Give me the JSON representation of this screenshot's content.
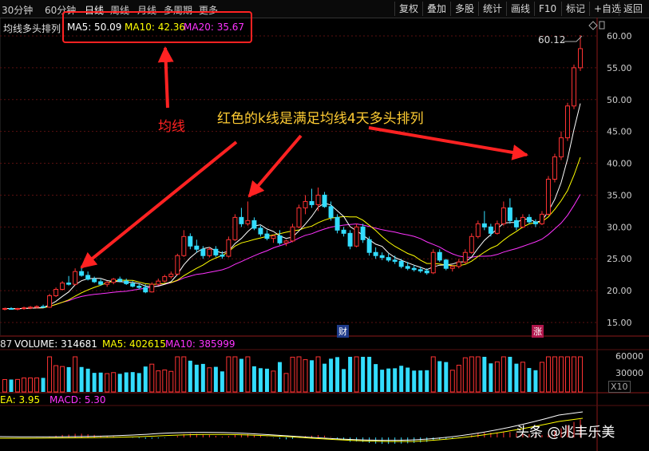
{
  "toolbar": {
    "timeframes": [
      "30分钟",
      "60分钟",
      "日线",
      "周线",
      "月线",
      "多周期",
      "更多"
    ],
    "active_timeframe": "日线",
    "buttons": [
      "复权",
      "叠加",
      "多股",
      "统计",
      "画线",
      "F10",
      "标记",
      "+自选",
      "返回"
    ]
  },
  "main_panel": {
    "indicator_name": "均线多头排列",
    "ma5_label": "MA5: 50.09",
    "ma10_label": "MA10: 42.36",
    "ma20_label": "MA20: 35.67",
    "peak_label": "60.12",
    "markers": {
      "cai": "财",
      "zhang": "涨"
    }
  },
  "volume_panel": {
    "prefix": "87",
    "volume_label": "VOLUME: 314681",
    "ma5_label": "MA5: 402615",
    "ma10_label": "MA10: 385999",
    "y_ticks": [
      "60000",
      "30000"
    ],
    "x10": "X10"
  },
  "macd_panel": {
    "dea_label": "EA: 3.95",
    "macd_label": "MACD: 5.30"
  },
  "annotations": {
    "ma_text": "均线",
    "pattern_text": "红色的k线是满足均线4天多头排列"
  },
  "watermark": "头条 @兆丰乐美",
  "colors": {
    "up": "#ff3333",
    "down": "#33ddff",
    "ma5": "#ffffff",
    "ma10": "#ffff00",
    "ma20": "#ff33ff",
    "annotation": "#ff2222"
  },
  "chart_data": {
    "type": "candlestick",
    "y_ticks": [
      15,
      20,
      25,
      30,
      35,
      40,
      45,
      50,
      55,
      60
    ],
    "ylim": [
      12.5,
      61.5
    ],
    "candles": [
      [
        17.1,
        17.3,
        16.9,
        17.2
      ],
      [
        17.2,
        17.4,
        17.0,
        17.1
      ],
      [
        17.1,
        17.3,
        16.9,
        17.2
      ],
      [
        17.2,
        17.5,
        17.0,
        17.3
      ],
      [
        17.3,
        17.6,
        17.1,
        17.4
      ],
      [
        17.4,
        17.7,
        17.2,
        17.5
      ],
      [
        17.5,
        17.8,
        17.3,
        17.4
      ],
      [
        17.4,
        19.5,
        17.3,
        19.2
      ],
      [
        19.2,
        20.5,
        19.0,
        20.2
      ],
      [
        20.2,
        21.5,
        20.0,
        21.2
      ],
      [
        21.2,
        22.3,
        20.8,
        21.0
      ],
      [
        21.0,
        23.5,
        20.8,
        23.0
      ],
      [
        23.0,
        23.8,
        22.2,
        22.4
      ],
      [
        22.4,
        23.0,
        21.6,
        21.8
      ],
      [
        21.8,
        22.2,
        21.2,
        21.4
      ],
      [
        21.4,
        21.8,
        20.8,
        21.0
      ],
      [
        21.0,
        21.5,
        20.6,
        21.3
      ],
      [
        21.3,
        22.0,
        21.0,
        21.8
      ],
      [
        21.8,
        22.2,
        21.3,
        21.5
      ],
      [
        21.5,
        21.9,
        20.9,
        21.1
      ],
      [
        21.1,
        21.5,
        20.5,
        20.7
      ],
      [
        20.7,
        21.1,
        20.2,
        20.5
      ],
      [
        20.5,
        21.0,
        19.6,
        19.8
      ],
      [
        19.8,
        21.3,
        19.7,
        21.0
      ],
      [
        21.0,
        21.9,
        20.8,
        21.5
      ],
      [
        21.5,
        22.5,
        21.3,
        22.2
      ],
      [
        22.2,
        23.0,
        21.9,
        22.6
      ],
      [
        22.6,
        25.8,
        22.4,
        25.5
      ],
      [
        25.5,
        29.5,
        25.3,
        28.5
      ],
      [
        28.5,
        29.0,
        26.5,
        27.0
      ],
      [
        27.0,
        28.0,
        26.0,
        26.5
      ],
      [
        26.5,
        27.0,
        25.0,
        25.5
      ],
      [
        25.5,
        26.8,
        25.2,
        26.5
      ],
      [
        26.5,
        27.0,
        25.3,
        25.6
      ],
      [
        25.6,
        26.2,
        25.0,
        25.4
      ],
      [
        25.4,
        28.5,
        25.2,
        28.0
      ],
      [
        28.0,
        32.0,
        27.8,
        31.5
      ],
      [
        31.5,
        33.0,
        30.0,
        30.5
      ],
      [
        30.5,
        34.0,
        30.2,
        31.0
      ],
      [
        31.0,
        31.5,
        29.5,
        29.8
      ],
      [
        29.8,
        30.2,
        28.5,
        28.9
      ],
      [
        28.9,
        29.5,
        27.9,
        28.2
      ],
      [
        28.2,
        28.8,
        27.5,
        28.6
      ],
      [
        28.6,
        29.5,
        27.2,
        27.5
      ],
      [
        27.5,
        28.0,
        27.0,
        27.8
      ],
      [
        27.8,
        30.5,
        27.6,
        30.0
      ],
      [
        30.0,
        33.5,
        29.8,
        33.0
      ],
      [
        33.0,
        35.0,
        32.0,
        34.0
      ],
      [
        34.0,
        36.0,
        33.0,
        33.5
      ],
      [
        33.5,
        36.2,
        32.5,
        35.0
      ],
      [
        35.0,
        35.5,
        33.0,
        33.2
      ],
      [
        33.2,
        34.0,
        31.0,
        31.5
      ],
      [
        31.5,
        32.0,
        29.0,
        29.5
      ],
      [
        29.5,
        30.0,
        28.5,
        29.0
      ],
      [
        29.0,
        29.5,
        26.5,
        27.0
      ],
      [
        27.0,
        30.5,
        26.8,
        30.0
      ],
      [
        30.0,
        30.5,
        27.5,
        28.0
      ],
      [
        28.0,
        28.5,
        25.5,
        26.0
      ],
      [
        26.0,
        26.8,
        25.0,
        25.5
      ],
      [
        25.5,
        26.0,
        24.8,
        25.2
      ],
      [
        25.2,
        25.8,
        24.5,
        24.8
      ],
      [
        24.8,
        25.5,
        24.2,
        24.6
      ],
      [
        24.6,
        25.0,
        23.5,
        23.8
      ],
      [
        23.8,
        24.5,
        23.2,
        23.5
      ],
      [
        23.5,
        24.0,
        23.0,
        23.3
      ],
      [
        23.3,
        23.8,
        22.8,
        23.1
      ],
      [
        23.1,
        23.5,
        22.5,
        22.8
      ],
      [
        22.8,
        26.5,
        22.6,
        26.0
      ],
      [
        26.0,
        26.5,
        24.5,
        24.8
      ],
      [
        24.8,
        25.0,
        23.2,
        23.5
      ],
      [
        23.5,
        24.0,
        23.0,
        23.8
      ],
      [
        23.8,
        25.0,
        23.5,
        24.5
      ],
      [
        24.5,
        26.5,
        24.2,
        26.0
      ],
      [
        26.0,
        29.0,
        25.8,
        28.5
      ],
      [
        28.5,
        31.0,
        28.2,
        30.5
      ],
      [
        30.5,
        32.5,
        29.5,
        30.0
      ],
      [
        30.0,
        30.5,
        28.5,
        29.0
      ],
      [
        29.0,
        31.0,
        28.8,
        30.5
      ],
      [
        30.5,
        34.0,
        30.2,
        33.0
      ],
      [
        33.0,
        34.5,
        30.5,
        31.0
      ],
      [
        31.0,
        31.5,
        29.5,
        30.0
      ],
      [
        30.0,
        32.0,
        29.8,
        31.5
      ],
      [
        31.5,
        32.0,
        30.5,
        30.8
      ],
      [
        30.8,
        31.2,
        30.0,
        30.5
      ],
      [
        30.5,
        32.5,
        30.3,
        32.0
      ],
      [
        32.0,
        38.0,
        31.8,
        37.5
      ],
      [
        37.5,
        41.5,
        37.0,
        41.0
      ],
      [
        41.0,
        45.0,
        40.5,
        44.0
      ],
      [
        44.0,
        49.5,
        43.5,
        49.0
      ],
      [
        49.0,
        55.5,
        48.5,
        55.0
      ],
      [
        55.0,
        60.12,
        54.5,
        58.0
      ]
    ]
  }
}
